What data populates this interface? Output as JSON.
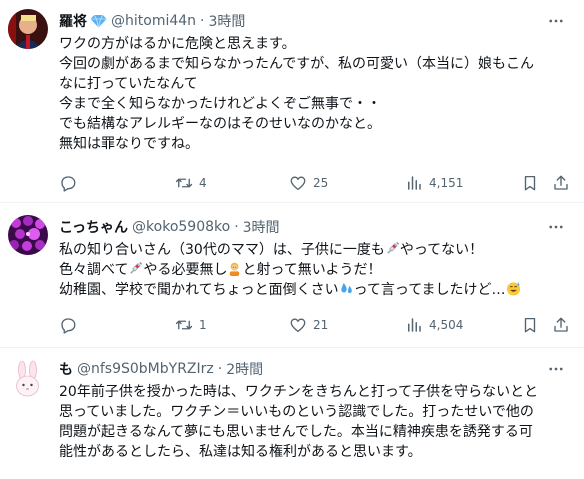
{
  "replies": [
    {
      "name": "羅将",
      "handle": "@hitomi44n",
      "dot": "·",
      "time": "3時間",
      "lines": [
        "ワクの方がはるかに危険と思えます。",
        "今回の劇があるまで知らなかったんですが、私の可愛い（本当に）娘もこん",
        "なに打っていたなんて",
        "今まで全く知らなかったけれどよくぞご無事で・・",
        "でも結構なアレルギーなのはそのせいなのかなと。",
        "無知は罪なりですね。"
      ],
      "stats": {
        "replies": "",
        "reposts": "4",
        "likes": "25",
        "views": "4,151"
      }
    },
    {
      "name": "こっちゃん",
      "handle": "@koko5908ko",
      "dot": "·",
      "time": "3時間",
      "line1_a": "私の知り合いさん（30代のママ）は、子供に一度も",
      "line1_b": "やってない！",
      "line2_a": "色々調べて",
      "line2_b": "やる必要無し",
      "line2_c": "と射って無いようだ！",
      "line3_a": "幼稚園、学校で聞かれてちょっと面倒くさい",
      "line3_b": "って言ってましたけど…",
      "stats": {
        "replies": "",
        "reposts": "1",
        "likes": "21",
        "views": "4,504"
      }
    },
    {
      "name": "も",
      "handle": "@nfs9S0bMbYRZIrz",
      "dot": "·",
      "time": "2時間",
      "lines": [
        "20年前子供を授かった時は、ワクチンをきちんと打って子供を守らないとと",
        "思っていました。ワクチン＝いいものという認識でした。打ったせいで他の",
        "問題が起きるなんて夢にも思いませんでした。本当に精神疾患を誘発する可",
        "能性があるとしたら、私達は知る権利があると思います。"
      ]
    }
  ],
  "icons": [
    "verified-diamond-icon",
    "more-icon",
    "reply-icon",
    "repost-icon",
    "like-icon",
    "views-icon",
    "bookmark-icon",
    "share-icon",
    "syringe-icon",
    "woman-icon",
    "sweat-droplets-icon",
    "sweat-smile-icon"
  ],
  "colors": {
    "text": "#0f1419",
    "secondary": "#536471",
    "divider": "#eff3f4",
    "diamond": "#5ab0f0"
  }
}
